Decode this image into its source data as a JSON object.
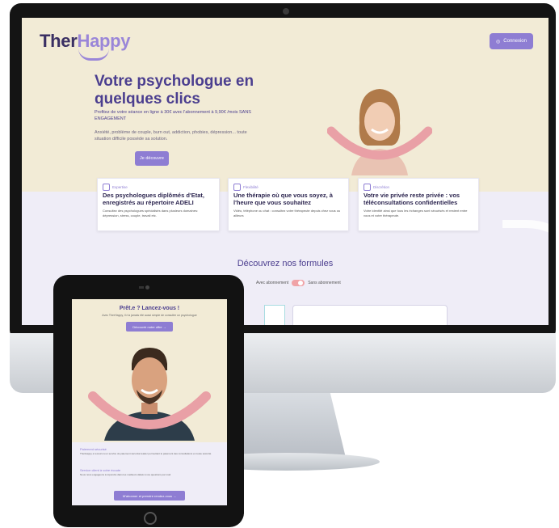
{
  "desktop": {
    "logo_part1": "Ther",
    "logo_part2": "Happy",
    "connexion_label": "Connexion",
    "hero_title": "Votre psychologue en quelques clics",
    "hero_subtitle": "Profitez de votre séance en ligne à 30€ avec l'abonnement à 9,90€ /mois SANS ENGAGEMENT",
    "hero_text": "Anxiété, problème de couple, burn out, addiction, phobies, dépression... toute situation difficile possède sa solution.",
    "hero_button": "Je découvre",
    "cards": [
      {
        "tag": "Expertise",
        "title": "Des psychologues diplômés d'Etat, enregistrés au répertoire ADELI",
        "desc": "Consultez des psychologues spécialisés dans plusieurs domaines: dépression, stress, couple, travail etc."
      },
      {
        "tag": "Flexibilité",
        "title": "Une thérapie où que vous soyez, à l'heure que vous souhaitez",
        "desc": "Vidéo, téléphone ou chat : consultez votre thérapeute depuis chez vous ou ailleurs"
      },
      {
        "tag": "Discrétion",
        "title": "Votre vie privée reste privée : vos téléconsultations confidentielles",
        "desc": "Votre identité ainsi que tous les échanges sont sécurisés et restent entre vous et votre thérapeute."
      }
    ],
    "formules_title": "Découvrez nos formules",
    "toggle_left": "Avec abonnement",
    "toggle_right": "Sans abonnement"
  },
  "tablet": {
    "title": "Prêt.e ? Lancez-vous !",
    "subtitle": "Avec TherHappy, il n'a jamais été aussi simple de consulter un psychologue",
    "button": "Découvrir notre offre  →",
    "items": [
      {
        "label": "Paiement sécurisé",
        "desc": "TherHappy a recours à un service de paiement sécurisé leader permettant le paiement des consultations en toute sécurité"
      },
      {
        "label": "Service client à votre écoute",
        "desc": "Nous nous engageons à répondre dans les meilleurs délais à vos questions par mail"
      }
    ],
    "cta": "M'abonner et prendre rendez-vous  →"
  },
  "colors": {
    "accent": "#8e7dd3",
    "title_purple": "#4b3e8f",
    "cream_bg": "#f2ebd6",
    "lavender_bg": "#efedf7",
    "smile_pink": "#e9a0a6"
  }
}
